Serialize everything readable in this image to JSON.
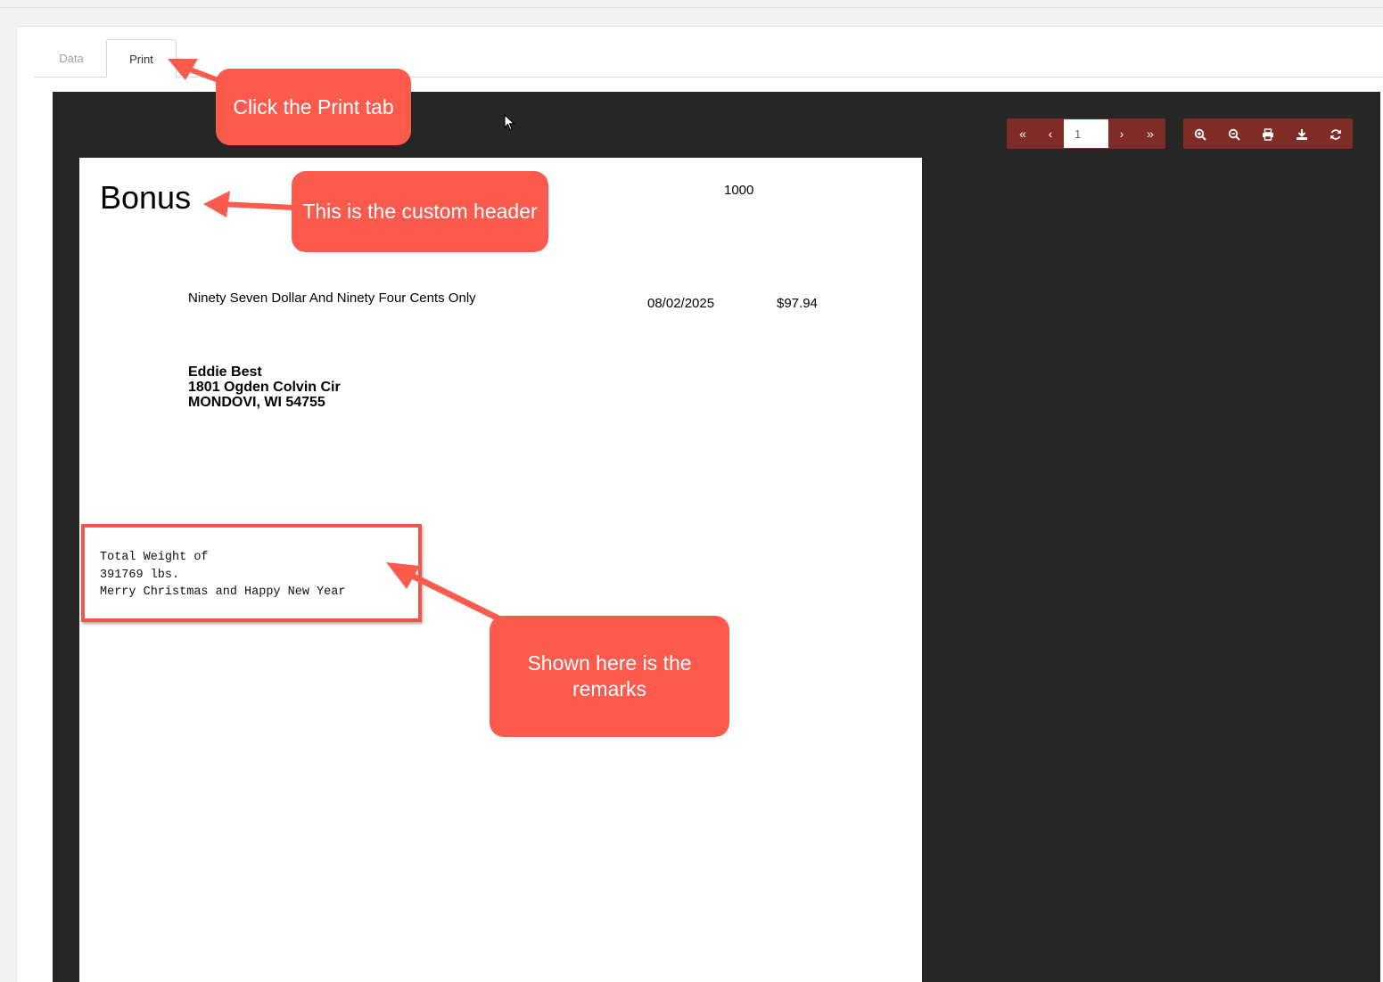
{
  "tabs": [
    {
      "label": "Data",
      "active": false
    },
    {
      "label": "Print",
      "active": true
    }
  ],
  "toolbar": {
    "first_icon": "«",
    "prev_icon": "‹",
    "page_value": "1",
    "next_icon": "›",
    "last_icon": "»",
    "tools": [
      "zoom-in-icon",
      "zoom-out-icon",
      "print-icon",
      "download-icon",
      "refresh-icon"
    ],
    "accent_color": "#7f2b26"
  },
  "document": {
    "header": "Bonus",
    "check_number": "1000",
    "amount_words": "Ninety Seven Dollar And Ninety Four Cents Only",
    "date": "08/02/2025",
    "amount": "$97.94",
    "payee": {
      "name": "Eddie Best",
      "street": "1801 Ogden Colvin Cir",
      "city": "MONDOVI, WI 54755"
    },
    "remarks": [
      "Total Weight of",
      "391769 lbs.",
      "Merry Christmas and Happy New Year"
    ]
  },
  "callouts": {
    "print_tab": "Click the Print tab",
    "header": "This is the custom header",
    "remarks": "Shown here is the remarks",
    "color": "#fb5a4c"
  }
}
